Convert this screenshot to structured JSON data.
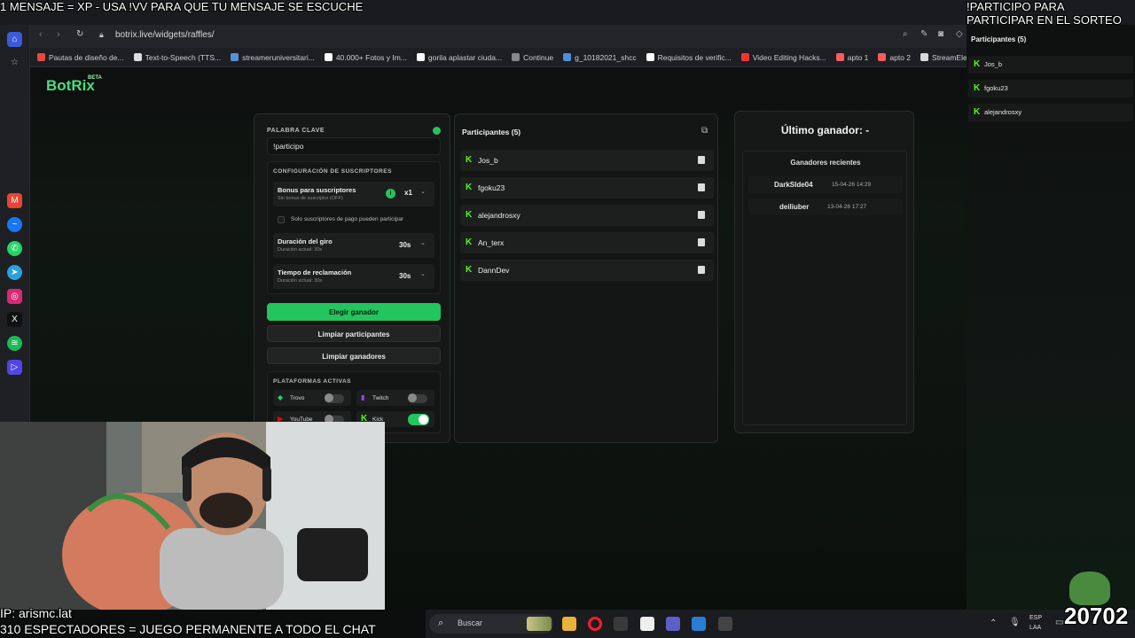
{
  "overlay": {
    "top_left": "1 MENSAJE = XP - USA !VV PARA QUE TU MENSAJE SE ESCUCHE",
    "top_right_line1": "!PARTICIPO PARA",
    "top_right_line2": "PARTICIPAR EN EL SORTEO",
    "bottom_ip": "IP: arismc.lat",
    "bottom_viewers": "310 ESPECTADORES = JUEGO PERMANENTE A TODO EL CHAT",
    "counter": "20702"
  },
  "browser": {
    "url": "botrix.live/widgets/raffles/",
    "bookmarks": [
      {
        "label": "Pautas de diseño de...",
        "color": "#e8493f"
      },
      {
        "label": "Text-to-Speech (TTS...",
        "color": "#dddddd"
      },
      {
        "label": "streameruniversitari...",
        "color": "#5a8fd8"
      },
      {
        "label": "40.000+ Fotos y Im...",
        "color": "#ffffff"
      },
      {
        "label": "gorila aplastar ciuda...",
        "color": "#ffffff"
      },
      {
        "label": "Continue",
        "color": "#888888"
      },
      {
        "label": "g_10182021_shcc",
        "color": "#4a90d9"
      },
      {
        "label": "Requisitos de verific...",
        "color": "#ffffff"
      },
      {
        "label": "Video Editing Hacks...",
        "color": "#ff3333"
      },
      {
        "label": "apto 1",
        "color": "#ff5a5f"
      },
      {
        "label": "apto 2",
        "color": "#ff5a5f"
      },
      {
        "label": "StreamElements - st...",
        "color": "#d9d9d9"
      }
    ]
  },
  "app": {
    "logo": "BotRix",
    "beta": "BETA",
    "keyword": {
      "label": "PALABRA CLAVE",
      "value": "!participo"
    },
    "subs_config": {
      "title": "CONFIGURACIÓN DE SUSCRIPTORES",
      "bonus_title": "Bonus para suscriptores",
      "bonus_sub": "Sin bonus de suscriptor (OFF)",
      "bonus_value": "x1",
      "only_subs": "Solo suscriptores de pago pueden participar",
      "spin_title": "Duración del giro",
      "spin_sub": "Duración actual: 30s",
      "spin_value": "30s",
      "claim_title": "Tiempo de reclamación",
      "claim_sub": "Duración actual: 30s",
      "claim_value": "30s"
    },
    "buttons": {
      "pick_winner": "Elegir ganador",
      "clear_participants": "Limpiar participantes",
      "clear_winners": "Limpiar ganadores"
    },
    "platforms": {
      "title": "PLATAFORMAS ACTIVAS",
      "items": [
        {
          "name": "Trovo",
          "on": false
        },
        {
          "name": "Twitch",
          "on": false
        },
        {
          "name": "YouTube",
          "on": false
        },
        {
          "name": "Kick",
          "on": true
        }
      ]
    },
    "participants": {
      "title": "Participantes (5)",
      "list": [
        "Jos_b",
        "fgoku23",
        "alejandrosxy",
        "An_terx",
        "DannDev"
      ]
    },
    "winner": {
      "title": "Último ganador: -",
      "recent_title": "Ganadores recientes",
      "recent": [
        {
          "name": "DarkSIde04",
          "date": "15-04-26 14:29"
        },
        {
          "name": "deiliuber",
          "date": "13-04-26 17:27"
        }
      ]
    }
  },
  "side_widget": {
    "title": "Participantes (5)",
    "list": [
      "Jos_b",
      "fgoku23",
      "alejandrosxy"
    ]
  },
  "taskbar": {
    "search": "Buscar",
    "lang1": "ESP",
    "lang2": "LAA"
  },
  "colors": {
    "accent": "#22c55e",
    "kick": "#53fc18"
  }
}
